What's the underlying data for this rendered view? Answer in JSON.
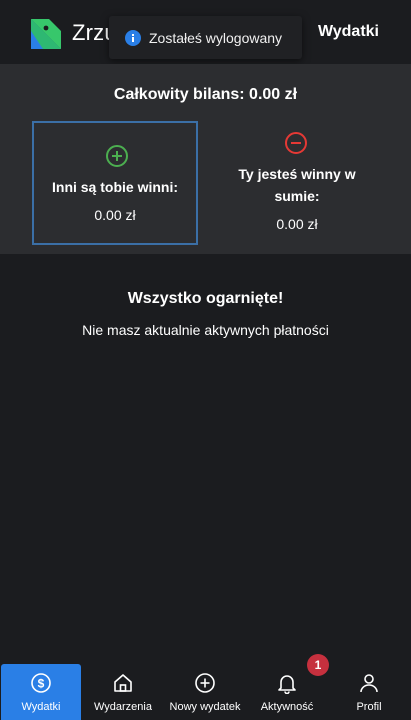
{
  "header": {
    "app_name": "Zrzu",
    "title": "Wydatki",
    "logo_icon": "app-logo-icon"
  },
  "toast": {
    "icon": "info-icon",
    "message": "Zostałeś wylogowany"
  },
  "balance": {
    "title": "Całkowity bilans: 0.00 zł",
    "owed_to_you": {
      "icon": "plus-circle-icon",
      "label": "Inni są tobie winni:",
      "value": "0.00 zł"
    },
    "you_owe": {
      "icon": "minus-circle-icon",
      "label": "Ty jesteś winny w sumie:",
      "value": "0.00 zł"
    }
  },
  "empty_state": {
    "title": "Wszystko ogarnięte!",
    "text": "Nie masz aktualnie aktywnych płatności"
  },
  "nav": {
    "items": [
      {
        "label": "Wydatki",
        "icon": "dollar-circle-icon",
        "active": true
      },
      {
        "label": "Wydarzenia",
        "icon": "home-icon",
        "active": false
      },
      {
        "label": "Nowy wydatek",
        "icon": "plus-circle-icon",
        "active": false
      },
      {
        "label": "Aktywność",
        "icon": "bell-icon",
        "active": false,
        "badge": "1"
      },
      {
        "label": "Profil",
        "icon": "user-icon",
        "active": false
      }
    ]
  },
  "colors": {
    "background": "#1b1c1f",
    "panel": "#2c2d30",
    "accent": "#2a7fe6",
    "positive": "#4caf50",
    "negative": "#e53935",
    "badge": "#c6303e"
  }
}
